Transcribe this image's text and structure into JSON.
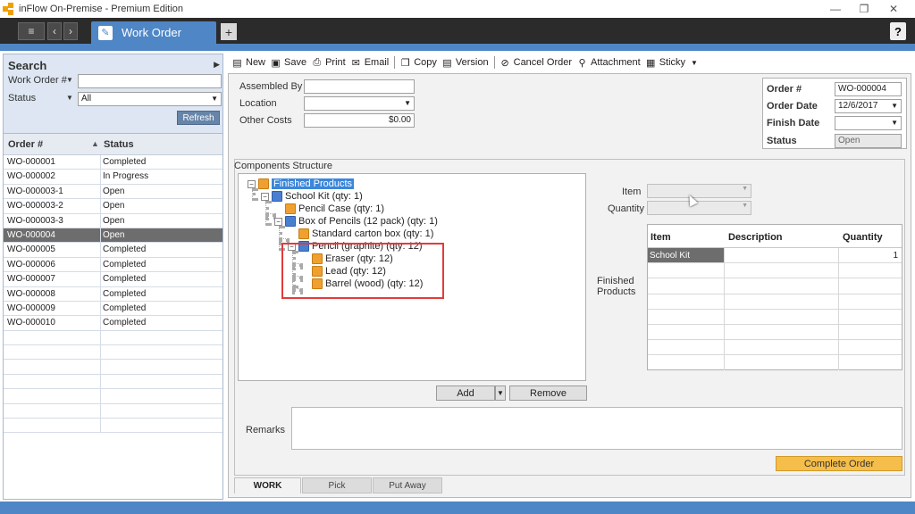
{
  "window": {
    "title": "inFlow On-Premise - Premium Edition",
    "minimize": "—",
    "restore": "❐",
    "close": "✕"
  },
  "tabbar": {
    "menu_glyph": "≡",
    "back_glyph": "‹",
    "forward_glyph": "›",
    "active_tab": "Work Order",
    "add_tab": "+",
    "help": "?"
  },
  "search": {
    "title": "Search",
    "collapse_glyph": "▶",
    "work_order_label": "Work Order #",
    "status_label": "Status",
    "status_value": "All",
    "refresh_label": "Refresh"
  },
  "order_list": {
    "columns": [
      "Order #",
      "Status"
    ],
    "sort_glyph": "▲",
    "rows": [
      {
        "order": "WO-000001",
        "status": "Completed"
      },
      {
        "order": "WO-000002",
        "status": "In Progress"
      },
      {
        "order": "WO-000003-1",
        "status": "Open"
      },
      {
        "order": "WO-000003-2",
        "status": "Open"
      },
      {
        "order": "WO-000003-3",
        "status": "Open"
      },
      {
        "order": "WO-000004",
        "status": "Open"
      },
      {
        "order": "WO-000005",
        "status": "Completed"
      },
      {
        "order": "WO-000006",
        "status": "Completed"
      },
      {
        "order": "WO-000007",
        "status": "Completed"
      },
      {
        "order": "WO-000008",
        "status": "Completed"
      },
      {
        "order": "WO-000009",
        "status": "Completed"
      },
      {
        "order": "WO-000010",
        "status": "Completed"
      }
    ],
    "selected_index": 5
  },
  "toolbar": {
    "new": "New",
    "save": "Save",
    "print": "Print",
    "email": "Email",
    "copy": "Copy",
    "version": "Version",
    "cancel_order": "Cancel Order",
    "attachment": "Attachment",
    "sticky": "Sticky"
  },
  "form": {
    "assembled_by_label": "Assembled By",
    "location_label": "Location",
    "other_costs_label": "Other Costs",
    "other_costs_value": "$0.00"
  },
  "order_info": {
    "order_no_label": "Order #",
    "order_no_value": "WO-000004",
    "order_date_label": "Order Date",
    "order_date_value": "12/6/2017",
    "finish_date_label": "Finish Date",
    "status_label": "Status",
    "status_value": "Open"
  },
  "components": {
    "title": "Components Structure",
    "tree": {
      "root": "Finished Products",
      "school_kit": "School Kit  (qty: 1)",
      "pencil_case": "Pencil Case  (qty: 1)",
      "box_of_pencils": "Box of Pencils (12 pack)  (qty: 1)",
      "carton_box": "Standard carton box  (qty: 1)",
      "pencil": "Pencil (graphite)  (qty: 12)",
      "eraser": "Eraser  (qty: 12)",
      "lead": "Lead  (qty: 12)",
      "barrel": "Barrel (wood)  (qty: 12)"
    },
    "item_label": "Item",
    "quantity_label": "Quantity",
    "finished_products_label": "Finished Products",
    "table_columns": [
      "Item",
      "Description",
      "Quantity"
    ],
    "table_rows": [
      {
        "item": "School Kit",
        "description": "",
        "quantity": "1"
      }
    ],
    "add_label": "Add",
    "remove_label": "Remove"
  },
  "remarks_label": "Remarks",
  "complete_order_label": "Complete Order",
  "bottom_tabs": [
    "WORK",
    "Pick",
    "Put Away"
  ]
}
